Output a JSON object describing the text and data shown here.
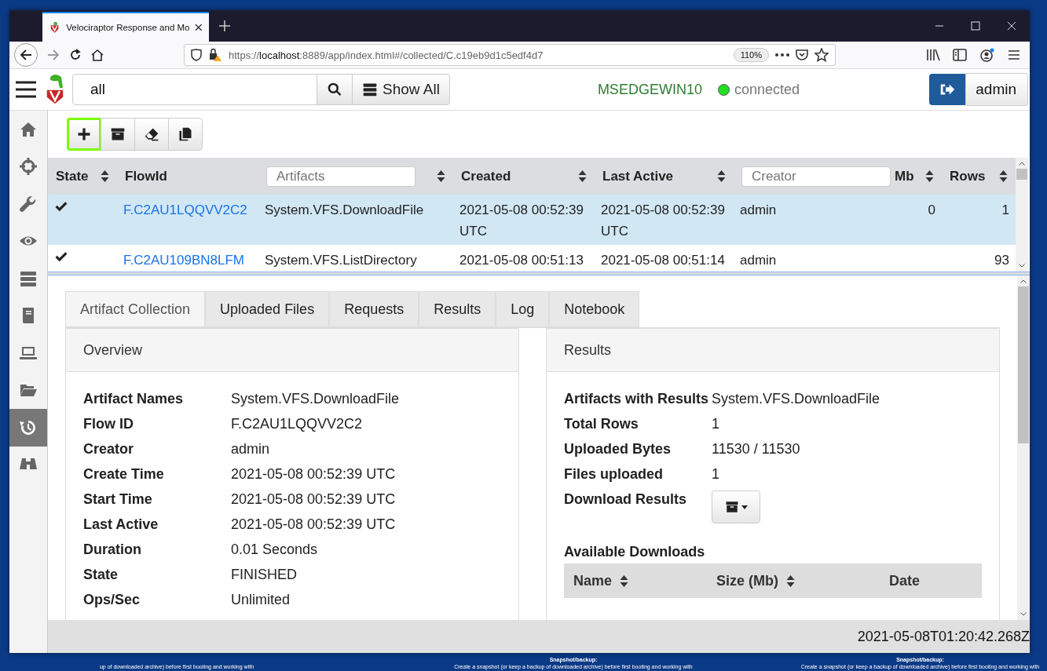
{
  "desktop": {
    "texts": [
      {
        "kind": "body",
        "text": "up of downloaded archive) before first booting and working with"
      },
      {
        "kind": "title",
        "text": "Snapshot/backup:"
      },
      {
        "kind": "body",
        "text": "Create a snapshot (or keep a backup of downloaded archive) before first booting and working with"
      },
      {
        "kind": "title",
        "text": "Snapshot/backup:"
      },
      {
        "kind": "body",
        "text": "Create a snapshot (or keep a backup of downloaded archive) before first booting and working with"
      }
    ]
  },
  "browser": {
    "tab": {
      "title": "Velociraptor Response and Mo"
    },
    "url": "https://**localhost**:8889/app/index.html#/collected/C.c19eb9d1c5edf4d7",
    "zoom": "110%"
  },
  "navbar": {
    "search": {
      "value": "all"
    },
    "show_all": "Show All",
    "client": "MSEDGEWIN10",
    "status": {
      "label": "connected",
      "color": "#22dd22"
    },
    "user": "admin"
  },
  "sidebar": {
    "items": [
      {
        "kind": "home",
        "selected": false
      },
      {
        "kind": "crosshair",
        "selected": false
      },
      {
        "kind": "wrench",
        "selected": false
      },
      {
        "kind": "eye",
        "selected": false
      },
      {
        "kind": "server",
        "selected": false
      },
      {
        "kind": "book",
        "selected": false
      },
      {
        "kind": "laptop",
        "selected": false
      },
      {
        "kind": "folder",
        "selected": false
      },
      {
        "kind": "history",
        "selected": true
      },
      {
        "kind": "binoculars",
        "selected": false
      }
    ]
  },
  "toolbar": {
    "buttons": [
      {
        "kind": "plus",
        "focused": true
      },
      {
        "kind": "archive",
        "focused": false
      },
      {
        "kind": "eraser",
        "focused": false
      },
      {
        "kind": "copy",
        "focused": false
      }
    ]
  },
  "flows": {
    "columns": [
      {
        "kind": "label",
        "label": "State"
      },
      {
        "kind": "plain",
        "label": "FlowId"
      },
      {
        "kind": "filter",
        "placeholder": "Artifacts"
      },
      {
        "kind": "label",
        "label": "Created"
      },
      {
        "kind": "label",
        "label": "Last Active"
      },
      {
        "kind": "filter",
        "placeholder": "Creator"
      },
      {
        "kind": "label",
        "label": "Mb"
      },
      {
        "kind": "label",
        "label": "Rows"
      }
    ],
    "rows": [
      {
        "selected": true,
        "kind": "finished",
        "flow_id": "F.C2AU1LQQVV2C2",
        "artifacts": "System.VFS.DownloadFile",
        "created": "2021-05-08 00:52:39 UTC",
        "last_active": "2021-05-08 00:52:39 UTC",
        "creator": "admin",
        "mb": "0",
        "rows": "1"
      },
      {
        "selected": false,
        "kind": "finished",
        "flow_id": "F.C2AU109BN8LFM",
        "artifacts": "System.VFS.ListDirectory",
        "created": "2021-05-08 00:51:13",
        "last_active": "2021-05-08 00:51:14",
        "creator": "admin",
        "rows": "93"
      }
    ]
  },
  "details": {
    "tabs": [
      {
        "label": "Artifact Collection",
        "selected": true
      },
      {
        "label": "Uploaded Files",
        "selected": false
      },
      {
        "label": "Requests",
        "selected": false
      },
      {
        "label": "Results",
        "selected": false
      },
      {
        "label": "Log",
        "selected": false
      },
      {
        "label": "Notebook",
        "selected": false
      }
    ],
    "overview": {
      "title": "Overview",
      "fields": [
        {
          "label": "Artifact Names",
          "value": "System.VFS.DownloadFile"
        },
        {
          "label": "Flow ID",
          "value": "F.C2AU1LQQVV2C2"
        },
        {
          "label": "Creator",
          "value": "admin"
        },
        {
          "label": "Create Time",
          "value": "2021-05-08 00:52:39 UTC"
        },
        {
          "label": "Start Time",
          "value": "2021-05-08 00:52:39 UTC"
        },
        {
          "label": "Last Active",
          "value": "2021-05-08 00:52:39 UTC"
        },
        {
          "label": "Duration",
          "value": "0.01 Seconds"
        },
        {
          "label": "State",
          "value": "FINISHED"
        },
        {
          "label": "Ops/Sec",
          "value": "Unlimited"
        }
      ]
    },
    "results": {
      "title": "Results",
      "fields": [
        {
          "kind": "text",
          "label": "Artifacts with Results",
          "value": "System.VFS.DownloadFile"
        },
        {
          "kind": "text",
          "label": "Total Rows",
          "value": "1"
        },
        {
          "kind": "text",
          "label": "Uploaded Bytes",
          "value": "11530 / 11530"
        },
        {
          "kind": "text",
          "label": "Files uploaded",
          "value": "1"
        },
        {
          "kind": "download",
          "label": "Download Results"
        }
      ],
      "downloads": {
        "title": "Available Downloads",
        "columns": [
          "Name",
          "Size (Mb)",
          "Date"
        ]
      }
    }
  },
  "footer": {
    "timestamp": "2021-05-08T01:20:42.268Z"
  }
}
